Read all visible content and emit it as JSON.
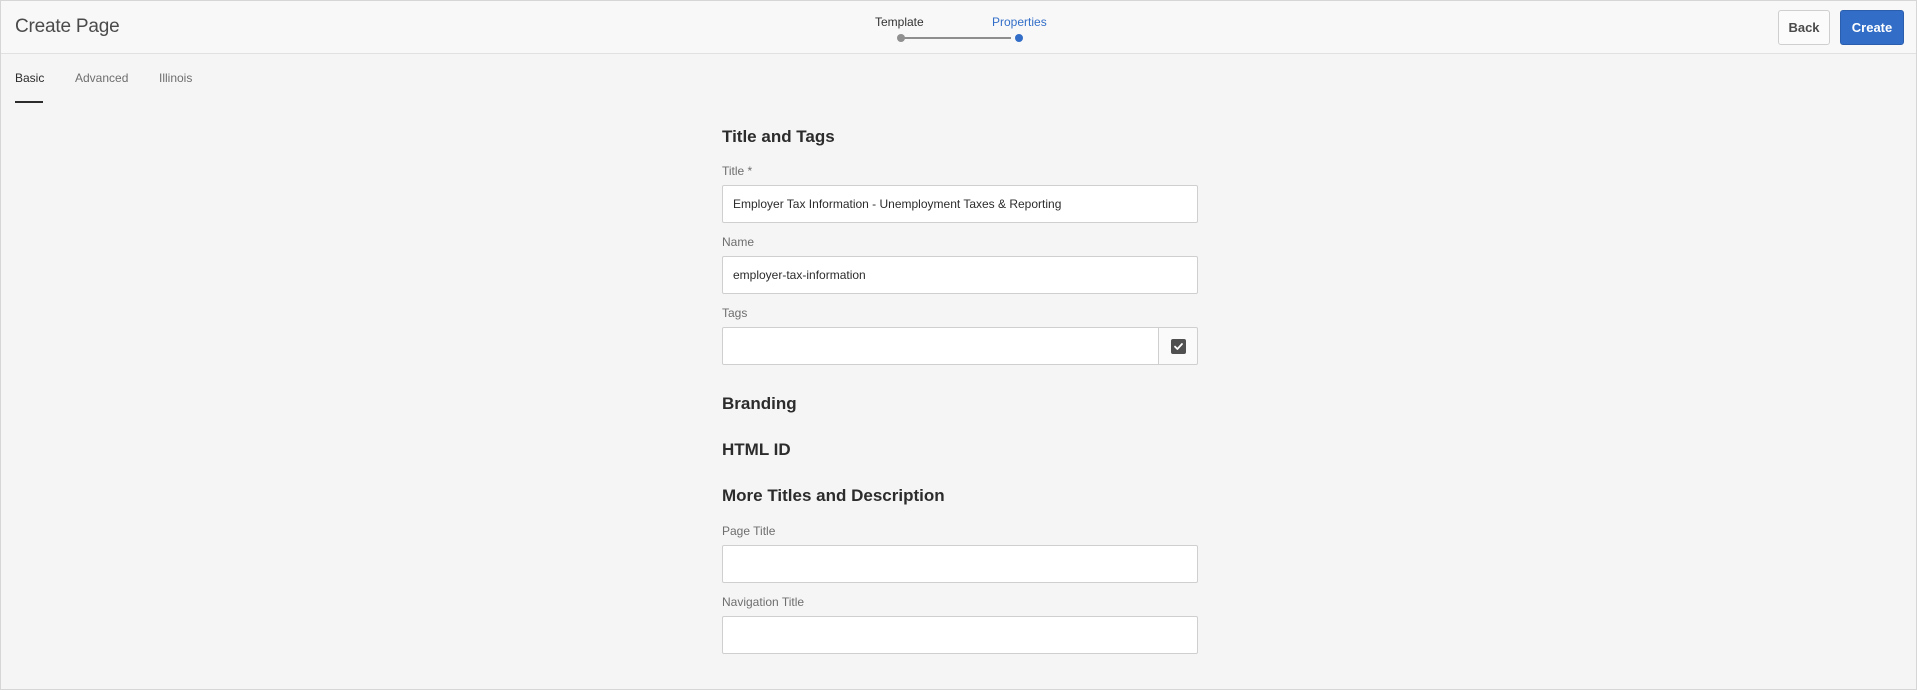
{
  "header": {
    "title": "Create Page",
    "wizard": {
      "steps": [
        {
          "label": "Template",
          "state": "complete"
        },
        {
          "label": "Properties",
          "state": "current"
        }
      ]
    },
    "back_label": "Back",
    "create_label": "Create"
  },
  "tabs": [
    {
      "label": "Basic",
      "active": true
    },
    {
      "label": "Advanced",
      "active": false
    },
    {
      "label": "Illinois",
      "active": false
    }
  ],
  "form": {
    "title_and_tags": {
      "heading": "Title and Tags",
      "title_label": "Title *",
      "title_value": "Employer Tax Information - Unemployment Taxes & Reporting",
      "name_label": "Name",
      "name_value": "employer-tax-information",
      "tags_label": "Tags",
      "tags_value": ""
    },
    "branding_heading": "Branding",
    "html_id_heading": "HTML ID",
    "more_titles": {
      "heading": "More Titles and Description",
      "page_title_label": "Page Title",
      "page_title_value": "",
      "navigation_title_label": "Navigation Title",
      "navigation_title_value": ""
    }
  },
  "colors": {
    "accent": "#326ec8",
    "background": "#f5f5f5",
    "text": "#2c2c2c"
  },
  "icons": {
    "tags_picker": "checkbox-checked-icon"
  }
}
